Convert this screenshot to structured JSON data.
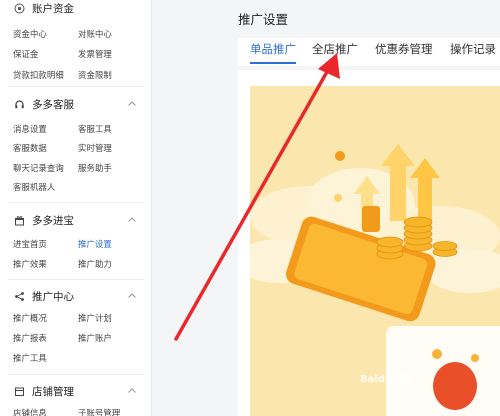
{
  "sidebar": {
    "sections": [
      {
        "title": "账户资金",
        "icon": "money-circle-icon",
        "items": [
          "资金中心",
          "对账中心",
          "保证金",
          "发票管理",
          "贷款扣款明细",
          "资金限制"
        ]
      },
      {
        "title": "多多客服",
        "icon": "headset-icon",
        "items": [
          "消息设置",
          "客服工具",
          "客服数据",
          "实时管理",
          "聊天记录查询",
          "服务助手",
          "客服机器人"
        ]
      },
      {
        "title": "多多进宝",
        "icon": "gift-box-icon",
        "items": [
          "进宝首页",
          "推广设置",
          "推广效果",
          "推广助力"
        ]
      },
      {
        "title": "推广中心",
        "icon": "share-icon",
        "items": [
          "推广概况",
          "推广计划",
          "推广报表",
          "推广账户",
          "推广工具"
        ]
      },
      {
        "title": "店铺管理",
        "icon": "store-icon",
        "items": [
          "店铺信息",
          "子账号管理"
        ]
      }
    ]
  },
  "main": {
    "title": "推广设置",
    "tabs": [
      "单品推广",
      "全店推广",
      "优惠券管理",
      "操作记录"
    ],
    "active_tab": "单品推广"
  },
  "watermark": "Baidu经验",
  "colors": {
    "accent": "#2d6fd6",
    "annotation_arrow": "#e8282b",
    "banner_bg": "#fbe7ae"
  }
}
